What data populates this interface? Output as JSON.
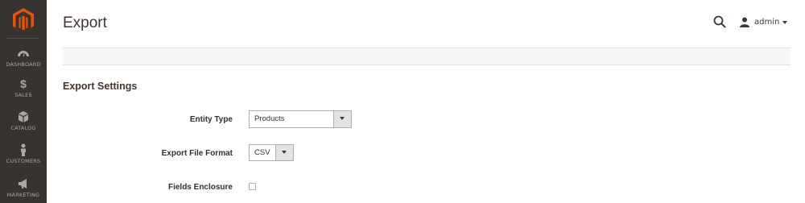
{
  "sidebar": {
    "items": [
      {
        "label": "DASHBOARD",
        "icon": "dashboard-icon"
      },
      {
        "label": "SALES",
        "icon": "dollar-icon",
        "glyph": "$"
      },
      {
        "label": "CATALOG",
        "icon": "box-icon"
      },
      {
        "label": "CUSTOMERS",
        "icon": "person-icon"
      },
      {
        "label": "MARKETING",
        "icon": "megaphone-icon"
      }
    ]
  },
  "header": {
    "title": "Export",
    "user_name": "admin"
  },
  "section": {
    "title": "Export Settings"
  },
  "form": {
    "entity_type": {
      "label": "Entity Type",
      "value": "Products"
    },
    "file_format": {
      "label": "Export File Format",
      "value": "CSV"
    },
    "fields_enclosure": {
      "label": "Fields Enclosure",
      "checked": false
    }
  },
  "colors": {
    "sidebar_bg": "#373330",
    "brand_orange": "#eb5202",
    "nav_text": "#aaa6a0"
  }
}
